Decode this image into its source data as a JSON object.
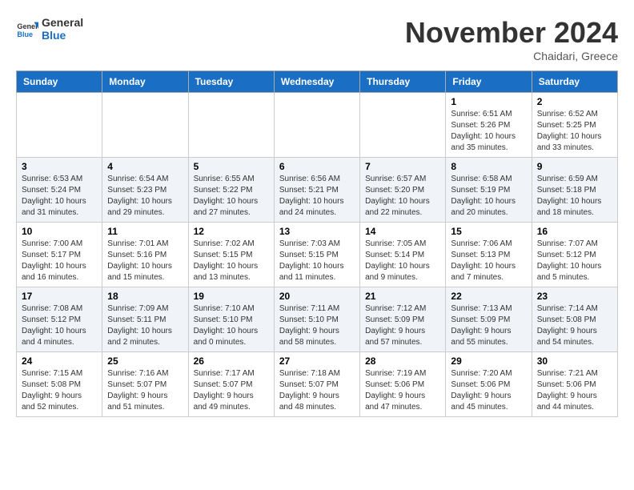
{
  "logo": {
    "line1": "General",
    "line2": "Blue"
  },
  "title": "November 2024",
  "location": "Chaidari, Greece",
  "days_header": [
    "Sunday",
    "Monday",
    "Tuesday",
    "Wednesday",
    "Thursday",
    "Friday",
    "Saturday"
  ],
  "weeks": [
    [
      {
        "num": "",
        "info": ""
      },
      {
        "num": "",
        "info": ""
      },
      {
        "num": "",
        "info": ""
      },
      {
        "num": "",
        "info": ""
      },
      {
        "num": "",
        "info": ""
      },
      {
        "num": "1",
        "info": "Sunrise: 6:51 AM\nSunset: 5:26 PM\nDaylight: 10 hours and 35 minutes."
      },
      {
        "num": "2",
        "info": "Sunrise: 6:52 AM\nSunset: 5:25 PM\nDaylight: 10 hours and 33 minutes."
      }
    ],
    [
      {
        "num": "3",
        "info": "Sunrise: 6:53 AM\nSunset: 5:24 PM\nDaylight: 10 hours and 31 minutes."
      },
      {
        "num": "4",
        "info": "Sunrise: 6:54 AM\nSunset: 5:23 PM\nDaylight: 10 hours and 29 minutes."
      },
      {
        "num": "5",
        "info": "Sunrise: 6:55 AM\nSunset: 5:22 PM\nDaylight: 10 hours and 27 minutes."
      },
      {
        "num": "6",
        "info": "Sunrise: 6:56 AM\nSunset: 5:21 PM\nDaylight: 10 hours and 24 minutes."
      },
      {
        "num": "7",
        "info": "Sunrise: 6:57 AM\nSunset: 5:20 PM\nDaylight: 10 hours and 22 minutes."
      },
      {
        "num": "8",
        "info": "Sunrise: 6:58 AM\nSunset: 5:19 PM\nDaylight: 10 hours and 20 minutes."
      },
      {
        "num": "9",
        "info": "Sunrise: 6:59 AM\nSunset: 5:18 PM\nDaylight: 10 hours and 18 minutes."
      }
    ],
    [
      {
        "num": "10",
        "info": "Sunrise: 7:00 AM\nSunset: 5:17 PM\nDaylight: 10 hours and 16 minutes."
      },
      {
        "num": "11",
        "info": "Sunrise: 7:01 AM\nSunset: 5:16 PM\nDaylight: 10 hours and 15 minutes."
      },
      {
        "num": "12",
        "info": "Sunrise: 7:02 AM\nSunset: 5:15 PM\nDaylight: 10 hours and 13 minutes."
      },
      {
        "num": "13",
        "info": "Sunrise: 7:03 AM\nSunset: 5:15 PM\nDaylight: 10 hours and 11 minutes."
      },
      {
        "num": "14",
        "info": "Sunrise: 7:05 AM\nSunset: 5:14 PM\nDaylight: 10 hours and 9 minutes."
      },
      {
        "num": "15",
        "info": "Sunrise: 7:06 AM\nSunset: 5:13 PM\nDaylight: 10 hours and 7 minutes."
      },
      {
        "num": "16",
        "info": "Sunrise: 7:07 AM\nSunset: 5:12 PM\nDaylight: 10 hours and 5 minutes."
      }
    ],
    [
      {
        "num": "17",
        "info": "Sunrise: 7:08 AM\nSunset: 5:12 PM\nDaylight: 10 hours and 4 minutes."
      },
      {
        "num": "18",
        "info": "Sunrise: 7:09 AM\nSunset: 5:11 PM\nDaylight: 10 hours and 2 minutes."
      },
      {
        "num": "19",
        "info": "Sunrise: 7:10 AM\nSunset: 5:10 PM\nDaylight: 10 hours and 0 minutes."
      },
      {
        "num": "20",
        "info": "Sunrise: 7:11 AM\nSunset: 5:10 PM\nDaylight: 9 hours and 58 minutes."
      },
      {
        "num": "21",
        "info": "Sunrise: 7:12 AM\nSunset: 5:09 PM\nDaylight: 9 hours and 57 minutes."
      },
      {
        "num": "22",
        "info": "Sunrise: 7:13 AM\nSunset: 5:09 PM\nDaylight: 9 hours and 55 minutes."
      },
      {
        "num": "23",
        "info": "Sunrise: 7:14 AM\nSunset: 5:08 PM\nDaylight: 9 hours and 54 minutes."
      }
    ],
    [
      {
        "num": "24",
        "info": "Sunrise: 7:15 AM\nSunset: 5:08 PM\nDaylight: 9 hours and 52 minutes."
      },
      {
        "num": "25",
        "info": "Sunrise: 7:16 AM\nSunset: 5:07 PM\nDaylight: 9 hours and 51 minutes."
      },
      {
        "num": "26",
        "info": "Sunrise: 7:17 AM\nSunset: 5:07 PM\nDaylight: 9 hours and 49 minutes."
      },
      {
        "num": "27",
        "info": "Sunrise: 7:18 AM\nSunset: 5:07 PM\nDaylight: 9 hours and 48 minutes."
      },
      {
        "num": "28",
        "info": "Sunrise: 7:19 AM\nSunset: 5:06 PM\nDaylight: 9 hours and 47 minutes."
      },
      {
        "num": "29",
        "info": "Sunrise: 7:20 AM\nSunset: 5:06 PM\nDaylight: 9 hours and 45 minutes."
      },
      {
        "num": "30",
        "info": "Sunrise: 7:21 AM\nSunset: 5:06 PM\nDaylight: 9 hours and 44 minutes."
      }
    ]
  ]
}
